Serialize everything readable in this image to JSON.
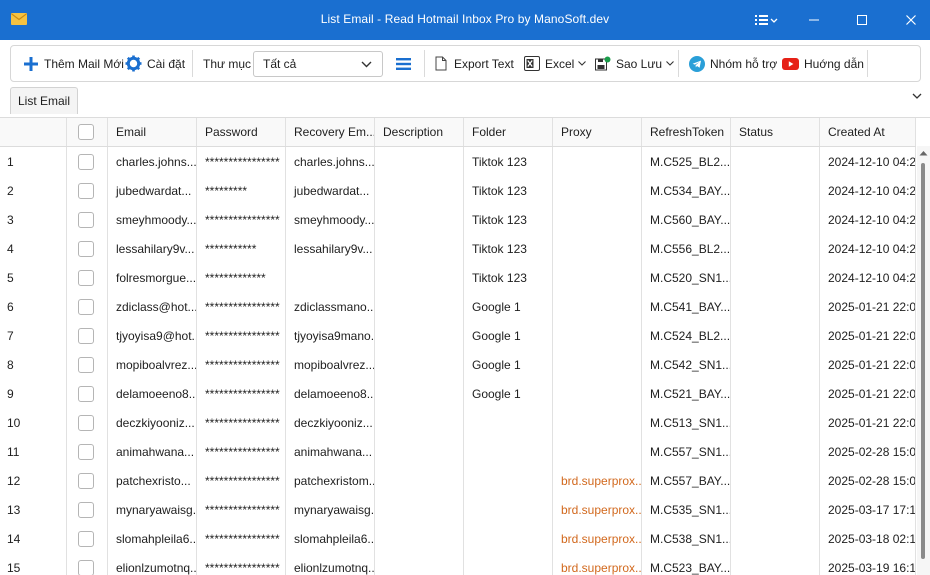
{
  "window": {
    "title": "List Email - Read Hotmail Inbox Pro by ManoSoft.dev"
  },
  "toolbar": {
    "add_mail": "Thêm Mail Mới",
    "settings": "Cài đặt",
    "folder_label": "Thư mục",
    "folder_value": "Tất cả",
    "export_text": "Export Text",
    "excel": "Excel",
    "backup": "Sao Lưu",
    "support_group": "Nhóm hỗ trợ",
    "guide": "Huớng dẫn"
  },
  "tabs": {
    "active": "List Email"
  },
  "table": {
    "columns": [
      "Email",
      "Password",
      "Recovery Em...",
      "Description",
      "Folder",
      "Proxy",
      "RefreshToken",
      "Status",
      "Created At"
    ],
    "rows": [
      {
        "n": "1",
        "email": "charles.johns...",
        "password": "****************",
        "recovery": "charles.johns...",
        "description": "",
        "folder": "Tiktok 123",
        "proxy": "",
        "token": "M.C525_BL2....",
        "status": "",
        "created": "2024-12-10 04:2..."
      },
      {
        "n": "2",
        "email": "jubedwardat...",
        "password": "*********",
        "recovery": "jubedwardat...",
        "description": "",
        "folder": "Tiktok 123",
        "proxy": "",
        "token": "M.C534_BAY...",
        "status": "",
        "created": "2024-12-10 04:2..."
      },
      {
        "n": "3",
        "email": "smeyhmoody...",
        "password": "****************",
        "recovery": "smeyhmoody...",
        "description": "",
        "folder": "Tiktok 123",
        "proxy": "",
        "token": "M.C560_BAY...",
        "status": "",
        "created": "2024-12-10 04:2..."
      },
      {
        "n": "4",
        "email": "lessahilary9v...",
        "password": "***********",
        "recovery": "lessahilary9v...",
        "description": "",
        "folder": "Tiktok 123",
        "proxy": "",
        "token": "M.C556_BL2....",
        "status": "",
        "created": "2024-12-10 04:2..."
      },
      {
        "n": "5",
        "email": "folresmorgue...",
        "password": "*************",
        "recovery": "",
        "description": "",
        "folder": "Tiktok 123",
        "proxy": "",
        "token": "M.C520_SN1...",
        "status": "",
        "created": "2024-12-10 04:2..."
      },
      {
        "n": "6",
        "email": "zdiclass@hot...",
        "password": "****************",
        "recovery": "zdiclassmano...",
        "description": "",
        "folder": "Google 1",
        "proxy": "",
        "token": "M.C541_BAY...",
        "status": "",
        "created": "2025-01-21 22:0..."
      },
      {
        "n": "7",
        "email": "tjyoyisa9@hot...",
        "password": "****************",
        "recovery": "tjyoyisa9mano...",
        "description": "",
        "folder": "Google 1",
        "proxy": "",
        "token": "M.C524_BL2....",
        "status": "",
        "created": "2025-01-21 22:0..."
      },
      {
        "n": "8",
        "email": "mopiboalvrez...",
        "password": "****************",
        "recovery": "mopiboalvrez...",
        "description": "",
        "folder": "Google 1",
        "proxy": "",
        "token": "M.C542_SN1...",
        "status": "",
        "created": "2025-01-21 22:0..."
      },
      {
        "n": "9",
        "email": "delamoeeno8...",
        "password": "****************",
        "recovery": "delamoeeno8...",
        "description": "",
        "folder": "Google 1",
        "proxy": "",
        "token": "M.C521_BAY...",
        "status": "",
        "created": "2025-01-21 22:0..."
      },
      {
        "n": "10",
        "email": "deczkiyooniz...",
        "password": "****************",
        "recovery": "deczkiyooniz...",
        "description": "",
        "folder": "",
        "proxy": "",
        "token": "M.C513_SN1...",
        "status": "",
        "created": "2025-01-21 22:0..."
      },
      {
        "n": "11",
        "email": "animahwana...",
        "password": "****************",
        "recovery": "animahwana...",
        "description": "",
        "folder": "",
        "proxy": "",
        "token": "M.C557_SN1...",
        "status": "",
        "created": "2025-02-28 15:0..."
      },
      {
        "n": "12",
        "email": "patchexristo...",
        "password": "****************",
        "recovery": "patchexristom...",
        "description": "",
        "folder": "",
        "proxy": "brd.superprox...",
        "token": "M.C557_BAY...",
        "status": "",
        "created": "2025-02-28 15:0..."
      },
      {
        "n": "13",
        "email": "mynaryawaisg...",
        "password": "****************",
        "recovery": "mynaryawaisg...",
        "description": "",
        "folder": "",
        "proxy": "brd.superprox...",
        "token": "M.C535_SN1...",
        "status": "",
        "created": "2025-03-17 17:1..."
      },
      {
        "n": "14",
        "email": "slomahpleila6...",
        "password": "****************",
        "recovery": "slomahpleila6...",
        "description": "",
        "folder": "",
        "proxy": "brd.superprox...",
        "token": "M.C538_SN1...",
        "status": "",
        "created": "2025-03-18 02:1..."
      },
      {
        "n": "15",
        "email": "elionlzumotnq...",
        "password": "****************",
        "recovery": "elionlzumotnq...",
        "description": "",
        "folder": "",
        "proxy": "brd.superprox...",
        "token": "M.C523_BAY...",
        "status": "",
        "created": "2025-03-19 16:1..."
      }
    ]
  },
  "colors": {
    "titlebar": "#1a6fd0",
    "proxy_text": "#d2691e"
  }
}
